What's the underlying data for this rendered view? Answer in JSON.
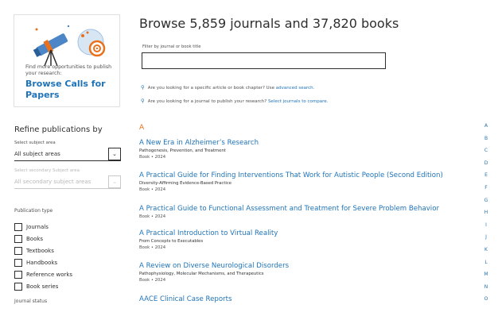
{
  "promo": {
    "text": "Find more opportunities to publish your research:",
    "link": "Browse Calls for Papers"
  },
  "header": {
    "title": "Browse 5,859 journals and 37,820 books"
  },
  "filter": {
    "label": "Filter by journal or book title",
    "value": ""
  },
  "hints": [
    {
      "text": "Are you looking for a specific article or book chapter? Use ",
      "link": "advanced search."
    },
    {
      "text": "Are you looking for a journal to publish your research? ",
      "link": "Select journals to compare."
    }
  ],
  "sidebar": {
    "refine_title": "Refine publications by",
    "subject_label": "Select subject area",
    "subject_value": "All subject areas",
    "secondary_label": "Select secondary Subject area",
    "secondary_value": "All secondary subject areas",
    "pubtype_label": "Publication type",
    "pubtypes": [
      "Journals",
      "Books",
      "Textbooks",
      "Handbooks",
      "Reference works",
      "Book series"
    ],
    "journal_status_label": "Journal status"
  },
  "list": {
    "letter": "A",
    "entries": [
      {
        "title": "A New Era in Alzheimer’s Research",
        "subtitle": "Pathogenesis, Prevention, and Treatment",
        "meta": "Book • 2024"
      },
      {
        "title": "A Practical Guide for Finding Interventions That Work for Autistic People (Second Edition)",
        "subtitle": "Diversity-Affirming Evidence-Based Practice",
        "meta": "Book • 2024"
      },
      {
        "title": "A Practical Guide to Functional Assessment and Treatment for Severe Problem Behavior",
        "subtitle": "",
        "meta": "Book • 2024"
      },
      {
        "title": "A Practical Introduction to Virtual Reality",
        "subtitle": "From Concepts to Executables",
        "meta": "Book • 2024"
      },
      {
        "title": "A Review on Diverse Neurological Disorders",
        "subtitle": "Pathophysiology, Molecular Mechanisms, and Therapeutics",
        "meta": "Book • 2024"
      },
      {
        "title": "AACE Clinical Case Reports",
        "subtitle": "",
        "meta": ""
      }
    ]
  },
  "alphabet": [
    "A",
    "B",
    "C",
    "D",
    "E",
    "F",
    "G",
    "H",
    "I",
    "J",
    "K",
    "L",
    "M",
    "N",
    "O"
  ]
}
